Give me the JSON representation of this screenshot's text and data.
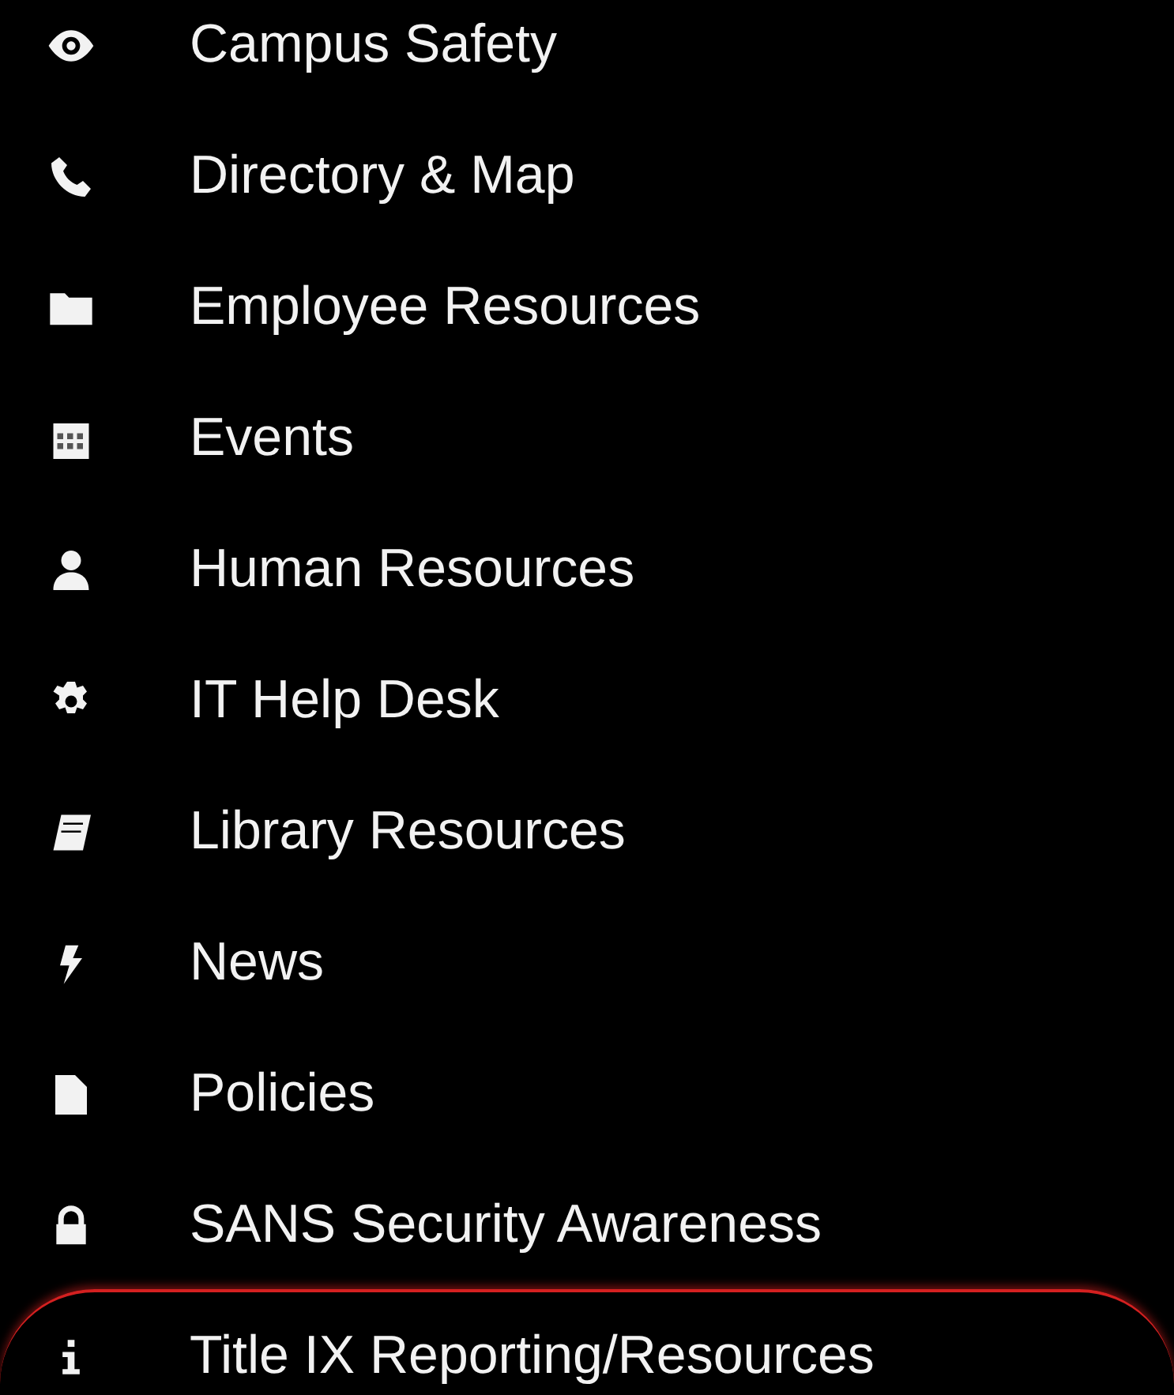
{
  "menu": {
    "items": [
      {
        "label": "Campus Safety",
        "highlighted": false
      },
      {
        "label": "Directory & Map",
        "highlighted": false
      },
      {
        "label": "Employee Resources",
        "highlighted": false
      },
      {
        "label": "Events",
        "highlighted": false
      },
      {
        "label": "Human Resources",
        "highlighted": false
      },
      {
        "label": "IT Help Desk",
        "highlighted": false
      },
      {
        "label": "Library Resources",
        "highlighted": false
      },
      {
        "label": "News",
        "highlighted": false
      },
      {
        "label": "Policies",
        "highlighted": false
      },
      {
        "label": "SANS Security Awareness",
        "highlighted": false
      },
      {
        "label": "Title IX Reporting/Resources",
        "highlighted": true
      }
    ]
  }
}
